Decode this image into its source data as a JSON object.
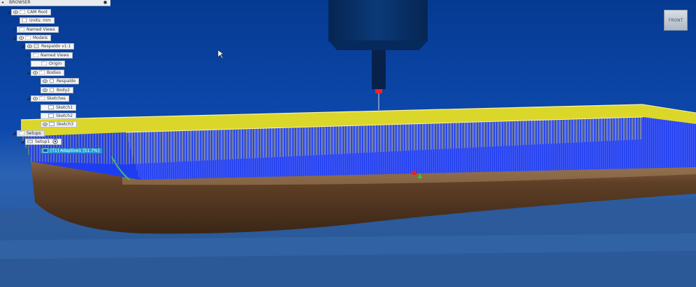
{
  "browser": {
    "title": "BROWSER",
    "tree": [
      {
        "label": "CAM Root",
        "level": 0,
        "expanded": true,
        "icon": "folder-icon"
      },
      {
        "label": "Units: mm",
        "level": 1,
        "expanded": null,
        "icon": "document-icon"
      },
      {
        "label": "Named Views",
        "level": 1,
        "expanded": false,
        "icon": "folder-icon"
      },
      {
        "label": "Models",
        "level": 1,
        "expanded": true,
        "icon": "folder-icon"
      },
      {
        "label": "Respaldo v1:1",
        "level": 2,
        "expanded": true,
        "icon": "component-icon"
      },
      {
        "label": "Named Views",
        "level": 3,
        "expanded": false,
        "icon": "folder-icon"
      },
      {
        "label": "Origin",
        "level": 3,
        "expanded": false,
        "icon": "folder-icon"
      },
      {
        "label": "Bodies",
        "level": 3,
        "expanded": true,
        "icon": "folder-icon"
      },
      {
        "label": "Respaldo",
        "level": 4,
        "expanded": null,
        "icon": "body-icon"
      },
      {
        "label": "Body2",
        "level": 4,
        "expanded": null,
        "icon": "body-icon"
      },
      {
        "label": "Sketches",
        "level": 3,
        "expanded": true,
        "icon": "folder-icon"
      },
      {
        "label": "Sketch1",
        "level": 4,
        "expanded": null,
        "icon": "sketch-icon"
      },
      {
        "label": "Sketch2",
        "level": 4,
        "expanded": null,
        "icon": "sketch-icon"
      },
      {
        "label": "Sketch3",
        "level": 4,
        "expanded": null,
        "icon": "sketch-icon"
      },
      {
        "label": "Setups",
        "level": 0,
        "expanded": true,
        "icon": "folder-icon"
      },
      {
        "label": "Setup1",
        "level": 1,
        "expanded": true,
        "icon": "setup-icon"
      },
      {
        "label": "[T1] Adaptive1 [51.7%]",
        "level": 2,
        "expanded": null,
        "icon": "operation-icon",
        "selected": true
      }
    ]
  },
  "view_cube": {
    "face": "FRONT"
  },
  "colors": {
    "background": "#0b3f98",
    "toolpath_yellow": "#f2e51c",
    "toolpath_blue": "#1f3df0",
    "wood": "#6b4a2f",
    "selection": "#2a9ad8"
  }
}
